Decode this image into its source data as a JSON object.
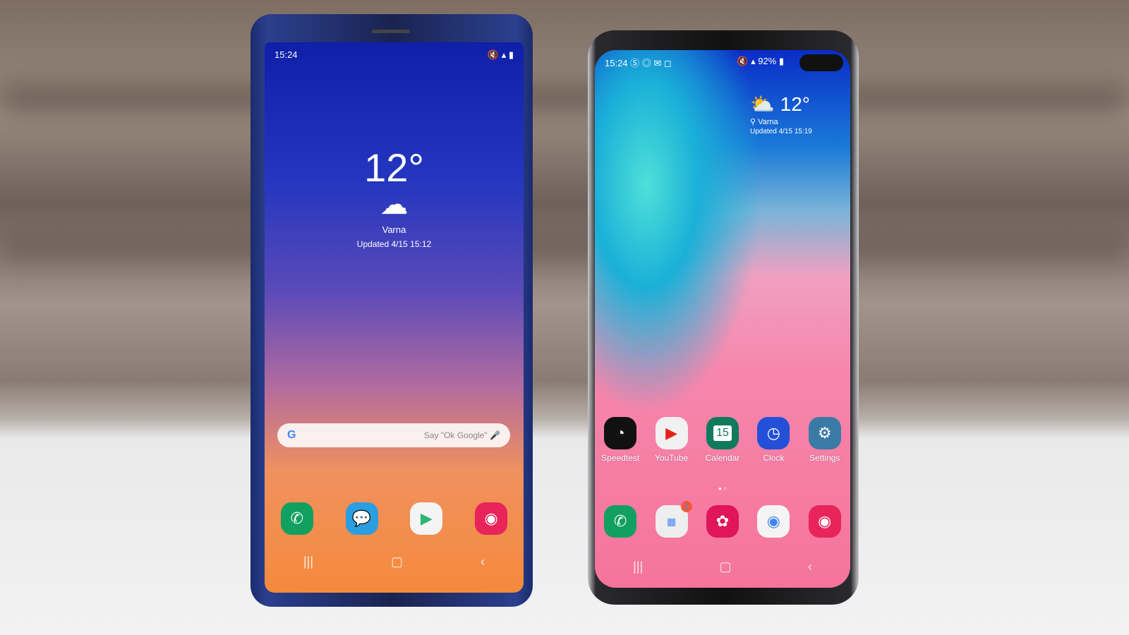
{
  "left_phone": {
    "status_time": "15:24",
    "weather": {
      "temperature": "12°",
      "location": "Varna",
      "updated": "Updated 4/15 15:12"
    },
    "search": {
      "logo": "G",
      "hint": "Say \"Ok Google\""
    },
    "dock": [
      {
        "icon": "phone-icon"
      },
      {
        "icon": "messages-icon"
      },
      {
        "icon": "play-store-icon"
      },
      {
        "icon": "camera-icon"
      }
    ]
  },
  "right_phone": {
    "status_time": "15:24",
    "battery": "92%",
    "weather": {
      "temperature": "12°",
      "location": "Varna",
      "updated": "Updated 4/15 15:19"
    },
    "apps": [
      {
        "label": "Speedtest",
        "color": "#111111"
      },
      {
        "label": "YouTube",
        "color": "#f1f1f1"
      },
      {
        "label": "Calendar",
        "color": "#0f7a5e",
        "day": "15"
      },
      {
        "label": "Clock",
        "color": "#2450d8"
      },
      {
        "label": "Settings",
        "color": "#3c7aa6"
      }
    ],
    "dock": [
      {
        "icon": "phone-icon"
      },
      {
        "icon": "google-folder-icon",
        "badge": "2"
      },
      {
        "icon": "gallery-icon"
      },
      {
        "icon": "chrome-icon"
      },
      {
        "icon": "camera-icon"
      }
    ]
  }
}
